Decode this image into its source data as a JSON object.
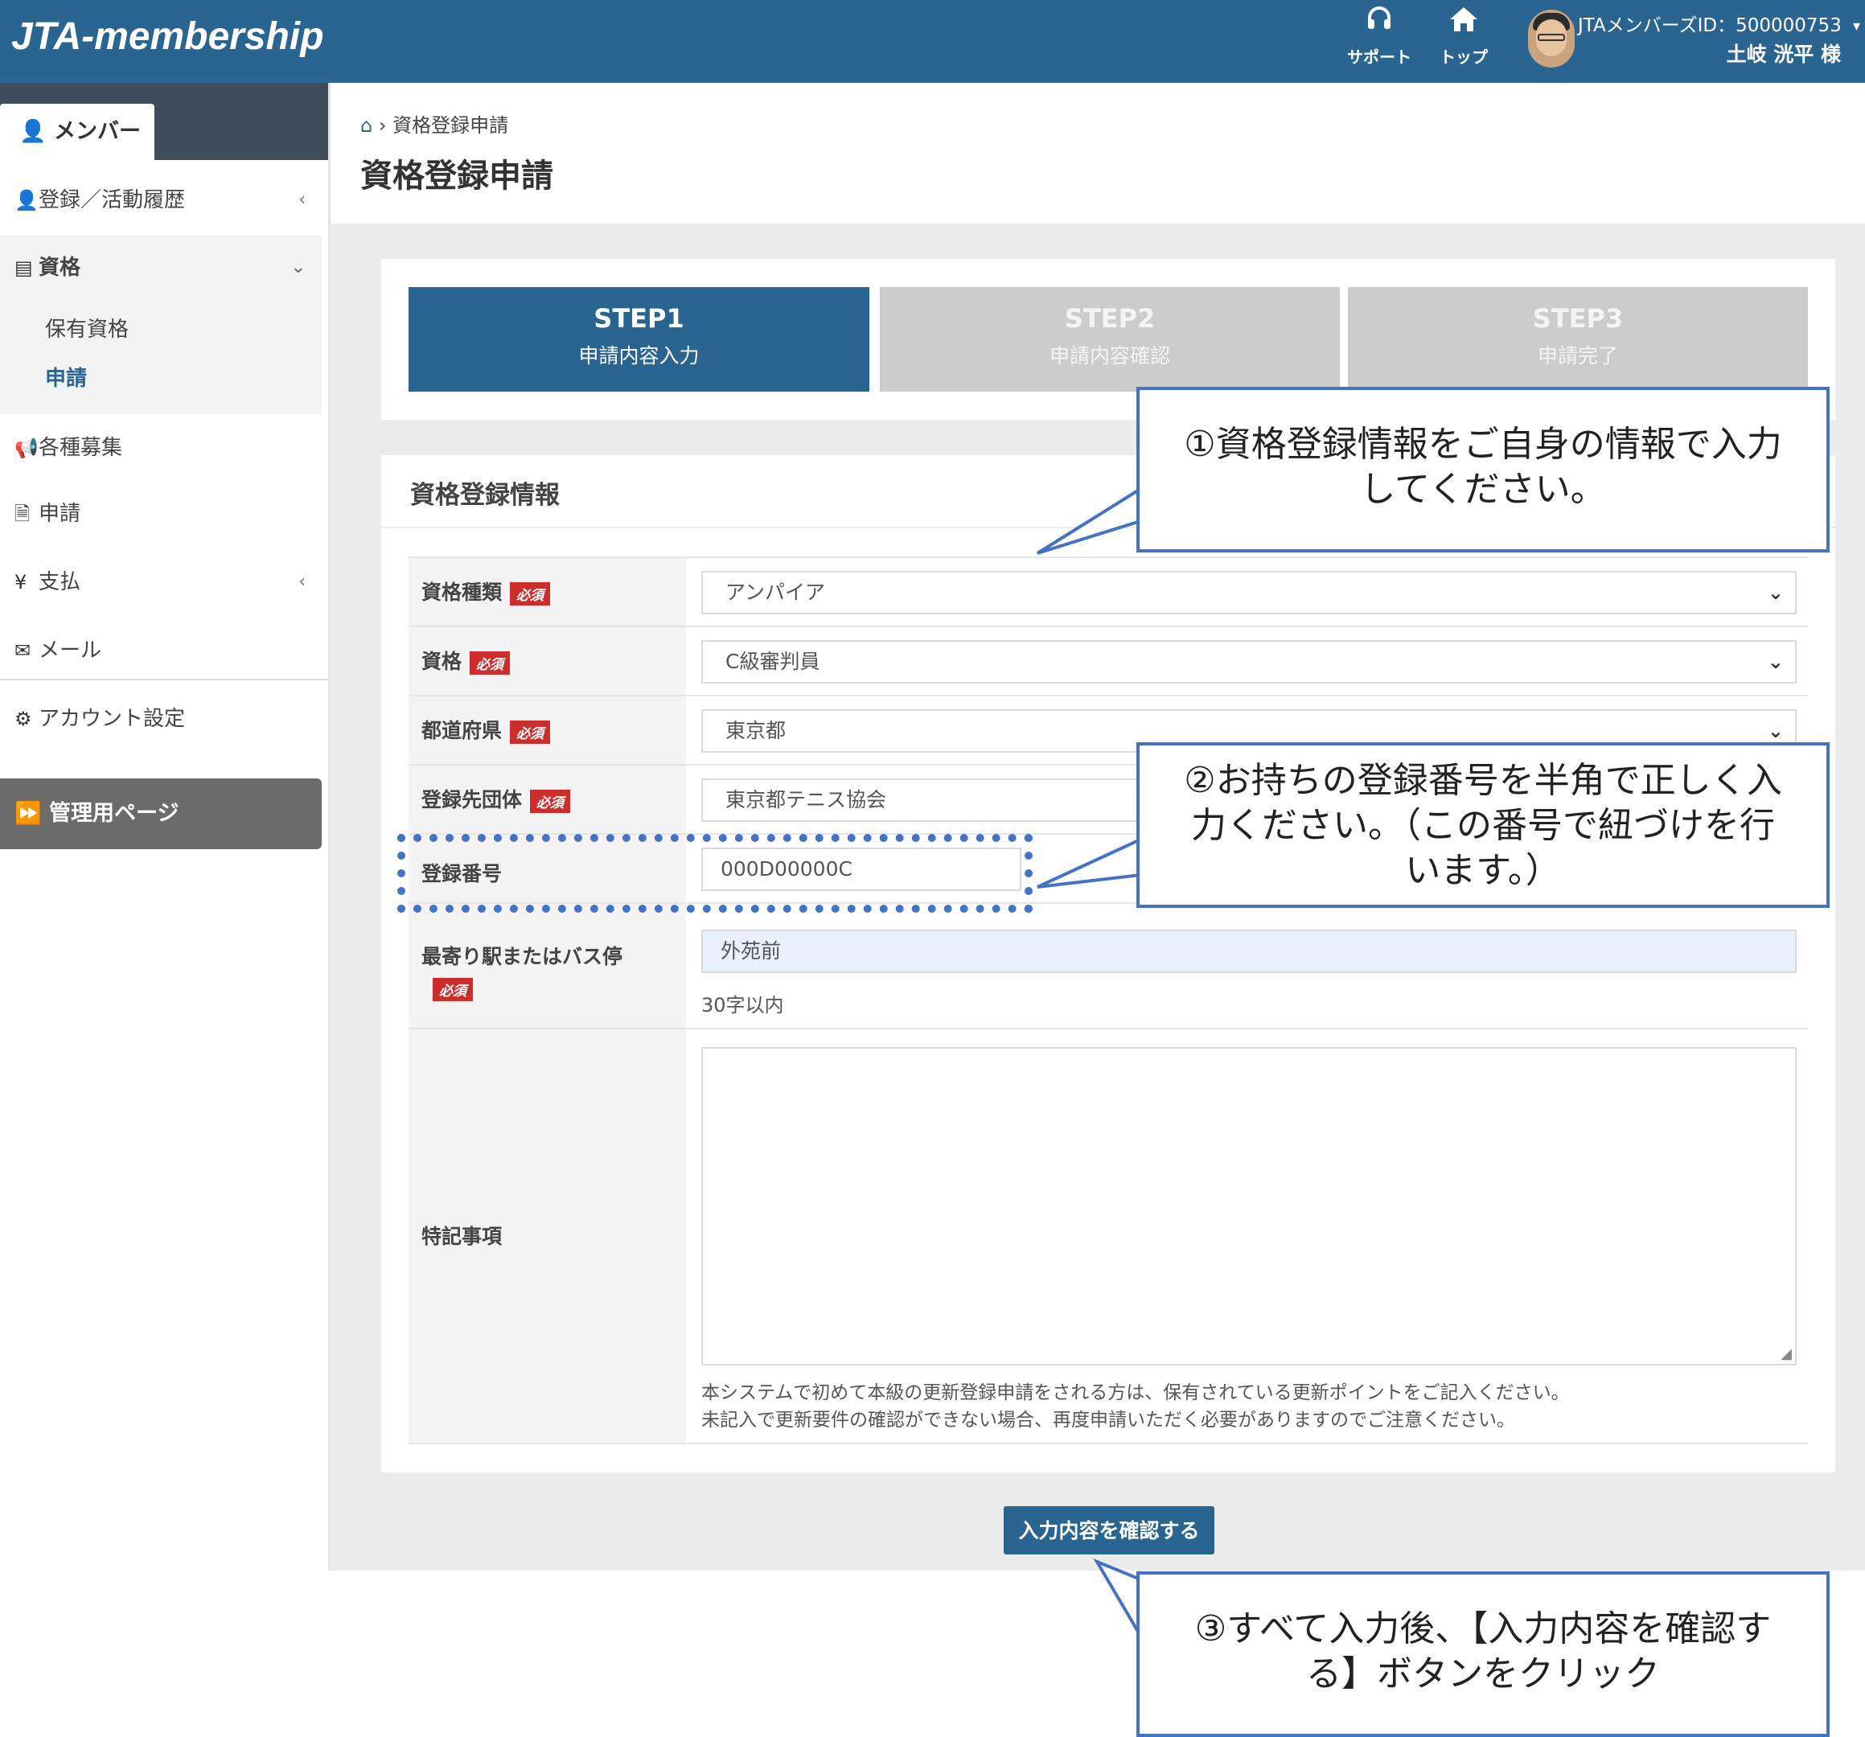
{
  "header": {
    "logo": "JTA-membership",
    "support_label": "サポート",
    "top_label": "トップ",
    "member_id": "JTAメンバーズID：500000753",
    "user_name": "土岐 洸平 様"
  },
  "sidebar": {
    "member_tab": "メンバー",
    "items": [
      {
        "label": "登録／活動履歴",
        "icon": "user-icon"
      },
      {
        "label": "資格",
        "icon": "id-card-icon"
      },
      {
        "label": "各種募集",
        "icon": "bullhorn-icon"
      },
      {
        "label": "申請",
        "icon": "file-icon"
      },
      {
        "label": "支払",
        "icon": "yen-icon"
      },
      {
        "label": "メール",
        "icon": "envelope-icon"
      },
      {
        "label": "アカウント設定",
        "icon": "user-gear-icon"
      }
    ],
    "sub_items": [
      "保有資格",
      "申請"
    ],
    "admin_label": "管理用ページ"
  },
  "breadcrumb": {
    "current": "資格登録申請"
  },
  "page_title": "資格登録申請",
  "steps": [
    {
      "title": "STEP1",
      "label": "申請内容入力"
    },
    {
      "title": "STEP2",
      "label": "申請内容確認"
    },
    {
      "title": "STEP3",
      "label": "申請完了"
    }
  ],
  "form": {
    "title": "資格登録情報",
    "required_badge": "必須",
    "fields": {
      "type": {
        "label": "資格種類",
        "value": "アンパイア"
      },
      "qualification": {
        "label": "資格",
        "value": "C級審判員"
      },
      "prefecture": {
        "label": "都道府県",
        "value": "東京都"
      },
      "organization": {
        "label": "登録先団体",
        "value": "東京都テニス協会"
      },
      "reg_number": {
        "label": "登録番号",
        "value": "000D00000C"
      },
      "station": {
        "label": "最寄り駅またはバス停",
        "value": "外苑前",
        "hint": "30字以内"
      },
      "notes": {
        "label": "特記事項",
        "hint1": "本システムで初めて本級の更新登録申請をされる方は、保有されている更新ポイントをご記入ください。",
        "hint2": "未記入で更新要件の確認ができない場合、再度申請いただく必要がありますのでご注意ください。"
      }
    },
    "confirm_button": "入力内容を確認する"
  },
  "callouts": {
    "c1_line1": "①資格登録情報をご自身の情報で入力",
    "c1_line2": "してください。",
    "c2_line1": "②お持ちの登録番号を半角で正しく入",
    "c2_line2": "力ください。（この番号で紐づけを行",
    "c2_line3": "います。）",
    "c3_line1": "③すべて入力後、【入力内容を確認す",
    "c3_line2": "る】ボタンをクリック"
  },
  "colors": {
    "primary": "#2a6592",
    "required": "#cc2e2e",
    "callout_border": "#4472c4"
  }
}
